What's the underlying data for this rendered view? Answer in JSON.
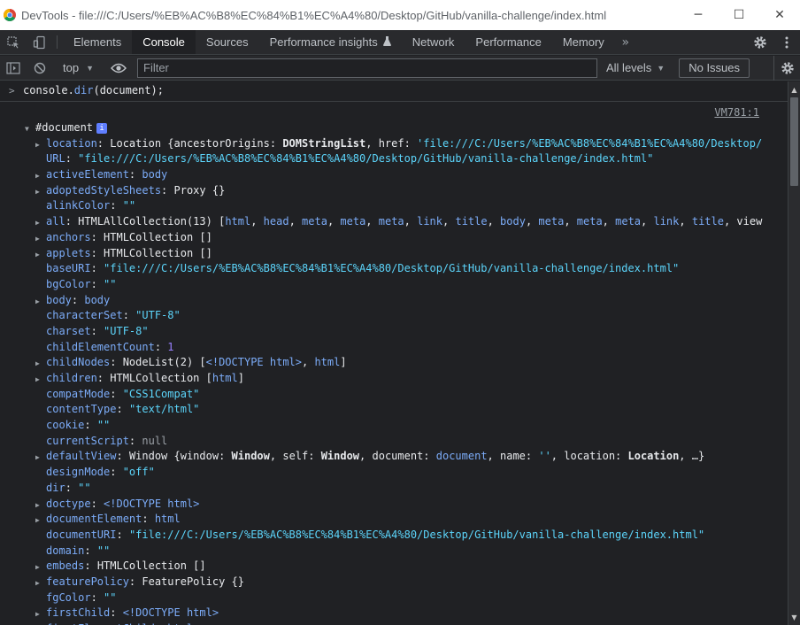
{
  "window": {
    "title": "DevTools - file:///C:/Users/%EB%AC%B8%EC%84%B1%EC%A4%80/Desktop/GitHub/vanilla-challenge/index.html",
    "minimize": "─",
    "maximize": "☐",
    "close": "✕"
  },
  "tabs": [
    {
      "label": "Elements"
    },
    {
      "label": "Console"
    },
    {
      "label": "Sources"
    },
    {
      "label": "Performance insights"
    },
    {
      "label": "Network"
    },
    {
      "label": "Performance"
    },
    {
      "label": "Memory"
    }
  ],
  "toolbar": {
    "context": "top",
    "filter_placeholder": "Filter",
    "levels": "All levels",
    "issues": "No Issues"
  },
  "console": {
    "command": "console.dir(document);",
    "source_link": "VM781:1",
    "object_name": "#document"
  },
  "icons": {
    "accent": "#7cacf8",
    "string": "#5cd5fb",
    "number": "#9980ff"
  }
}
